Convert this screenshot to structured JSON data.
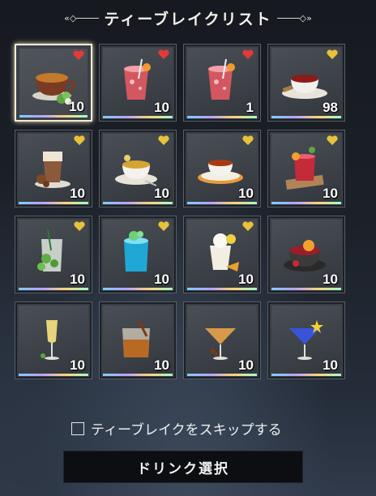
{
  "header": {
    "title": "ティーブレイクリスト"
  },
  "colors": {
    "heart_red": "#e23a3a",
    "heart_gold": "#e7c23a",
    "selected_border": "#f3ecd2"
  },
  "items": [
    {
      "qty": "10",
      "heart": "red",
      "icon": "tea-cup-icon"
    },
    {
      "qty": "10",
      "heart": "red",
      "icon": "red-fruit-drink-icon"
    },
    {
      "qty": "1",
      "heart": "red",
      "icon": "red-fruit-drink-icon"
    },
    {
      "qty": "98",
      "heart": "gold",
      "icon": "black-tea-icon"
    },
    {
      "qty": "10",
      "heart": "gold",
      "icon": "latte-icon"
    },
    {
      "qty": "10",
      "heart": "gold",
      "icon": "herbal-tea-icon"
    },
    {
      "qty": "10",
      "heart": "gold",
      "icon": "orange-tea-icon"
    },
    {
      "qty": "10",
      "heart": "gold",
      "icon": "iced-berry-tea-icon"
    },
    {
      "qty": "10",
      "heart": "gold",
      "icon": "mojito-icon"
    },
    {
      "qty": "10",
      "heart": "gold",
      "icon": "blue-soda-icon"
    },
    {
      "qty": "10",
      "heart": "gold",
      "icon": "parfait-icon"
    },
    {
      "qty": "10",
      "heart": "none",
      "icon": "fruit-punch-icon"
    },
    {
      "qty": "10",
      "heart": "none",
      "icon": "champagne-icon"
    },
    {
      "qty": "10",
      "heart": "none",
      "icon": "whiskey-icon"
    },
    {
      "qty": "10",
      "heart": "none",
      "icon": "cocktail-glass-icon"
    },
    {
      "qty": "10",
      "heart": "none",
      "icon": "blue-cocktail-icon"
    }
  ],
  "skip": {
    "label": "ティーブレイクをスキップする",
    "checked": false
  },
  "confirm_button": {
    "label": "ドリンク選択"
  }
}
